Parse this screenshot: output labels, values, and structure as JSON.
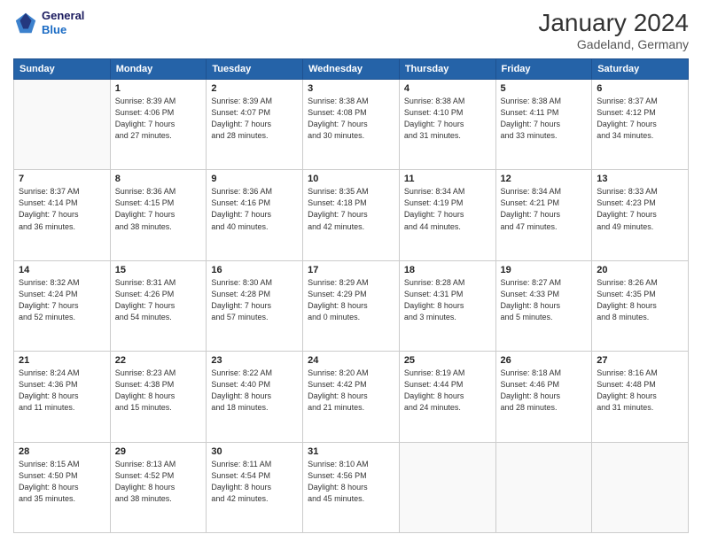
{
  "header": {
    "logo_line1": "General",
    "logo_line2": "Blue",
    "month": "January 2024",
    "location": "Gadeland, Germany"
  },
  "days_of_week": [
    "Sunday",
    "Monday",
    "Tuesday",
    "Wednesday",
    "Thursday",
    "Friday",
    "Saturday"
  ],
  "weeks": [
    [
      {
        "day": "",
        "info": ""
      },
      {
        "day": "1",
        "info": "Sunrise: 8:39 AM\nSunset: 4:06 PM\nDaylight: 7 hours\nand 27 minutes."
      },
      {
        "day": "2",
        "info": "Sunrise: 8:39 AM\nSunset: 4:07 PM\nDaylight: 7 hours\nand 28 minutes."
      },
      {
        "day": "3",
        "info": "Sunrise: 8:38 AM\nSunset: 4:08 PM\nDaylight: 7 hours\nand 30 minutes."
      },
      {
        "day": "4",
        "info": "Sunrise: 8:38 AM\nSunset: 4:10 PM\nDaylight: 7 hours\nand 31 minutes."
      },
      {
        "day": "5",
        "info": "Sunrise: 8:38 AM\nSunset: 4:11 PM\nDaylight: 7 hours\nand 33 minutes."
      },
      {
        "day": "6",
        "info": "Sunrise: 8:37 AM\nSunset: 4:12 PM\nDaylight: 7 hours\nand 34 minutes."
      }
    ],
    [
      {
        "day": "7",
        "info": "Sunrise: 8:37 AM\nSunset: 4:14 PM\nDaylight: 7 hours\nand 36 minutes."
      },
      {
        "day": "8",
        "info": "Sunrise: 8:36 AM\nSunset: 4:15 PM\nDaylight: 7 hours\nand 38 minutes."
      },
      {
        "day": "9",
        "info": "Sunrise: 8:36 AM\nSunset: 4:16 PM\nDaylight: 7 hours\nand 40 minutes."
      },
      {
        "day": "10",
        "info": "Sunrise: 8:35 AM\nSunset: 4:18 PM\nDaylight: 7 hours\nand 42 minutes."
      },
      {
        "day": "11",
        "info": "Sunrise: 8:34 AM\nSunset: 4:19 PM\nDaylight: 7 hours\nand 44 minutes."
      },
      {
        "day": "12",
        "info": "Sunrise: 8:34 AM\nSunset: 4:21 PM\nDaylight: 7 hours\nand 47 minutes."
      },
      {
        "day": "13",
        "info": "Sunrise: 8:33 AM\nSunset: 4:23 PM\nDaylight: 7 hours\nand 49 minutes."
      }
    ],
    [
      {
        "day": "14",
        "info": "Sunrise: 8:32 AM\nSunset: 4:24 PM\nDaylight: 7 hours\nand 52 minutes."
      },
      {
        "day": "15",
        "info": "Sunrise: 8:31 AM\nSunset: 4:26 PM\nDaylight: 7 hours\nand 54 minutes."
      },
      {
        "day": "16",
        "info": "Sunrise: 8:30 AM\nSunset: 4:28 PM\nDaylight: 7 hours\nand 57 minutes."
      },
      {
        "day": "17",
        "info": "Sunrise: 8:29 AM\nSunset: 4:29 PM\nDaylight: 8 hours\nand 0 minutes."
      },
      {
        "day": "18",
        "info": "Sunrise: 8:28 AM\nSunset: 4:31 PM\nDaylight: 8 hours\nand 3 minutes."
      },
      {
        "day": "19",
        "info": "Sunrise: 8:27 AM\nSunset: 4:33 PM\nDaylight: 8 hours\nand 5 minutes."
      },
      {
        "day": "20",
        "info": "Sunrise: 8:26 AM\nSunset: 4:35 PM\nDaylight: 8 hours\nand 8 minutes."
      }
    ],
    [
      {
        "day": "21",
        "info": "Sunrise: 8:24 AM\nSunset: 4:36 PM\nDaylight: 8 hours\nand 11 minutes."
      },
      {
        "day": "22",
        "info": "Sunrise: 8:23 AM\nSunset: 4:38 PM\nDaylight: 8 hours\nand 15 minutes."
      },
      {
        "day": "23",
        "info": "Sunrise: 8:22 AM\nSunset: 4:40 PM\nDaylight: 8 hours\nand 18 minutes."
      },
      {
        "day": "24",
        "info": "Sunrise: 8:20 AM\nSunset: 4:42 PM\nDaylight: 8 hours\nand 21 minutes."
      },
      {
        "day": "25",
        "info": "Sunrise: 8:19 AM\nSunset: 4:44 PM\nDaylight: 8 hours\nand 24 minutes."
      },
      {
        "day": "26",
        "info": "Sunrise: 8:18 AM\nSunset: 4:46 PM\nDaylight: 8 hours\nand 28 minutes."
      },
      {
        "day": "27",
        "info": "Sunrise: 8:16 AM\nSunset: 4:48 PM\nDaylight: 8 hours\nand 31 minutes."
      }
    ],
    [
      {
        "day": "28",
        "info": "Sunrise: 8:15 AM\nSunset: 4:50 PM\nDaylight: 8 hours\nand 35 minutes."
      },
      {
        "day": "29",
        "info": "Sunrise: 8:13 AM\nSunset: 4:52 PM\nDaylight: 8 hours\nand 38 minutes."
      },
      {
        "day": "30",
        "info": "Sunrise: 8:11 AM\nSunset: 4:54 PM\nDaylight: 8 hours\nand 42 minutes."
      },
      {
        "day": "31",
        "info": "Sunrise: 8:10 AM\nSunset: 4:56 PM\nDaylight: 8 hours\nand 45 minutes."
      },
      {
        "day": "",
        "info": ""
      },
      {
        "day": "",
        "info": ""
      },
      {
        "day": "",
        "info": ""
      }
    ]
  ]
}
